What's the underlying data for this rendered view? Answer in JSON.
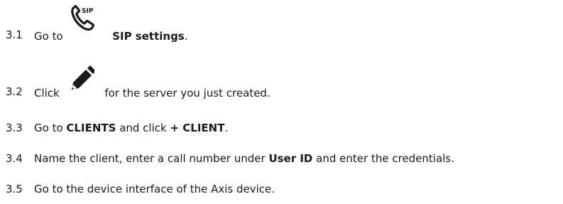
{
  "steps": [
    {
      "number": "3.1",
      "pre": "Go to",
      "icon": "sip-phone-icon",
      "bold": "SIP settings",
      "post": "."
    },
    {
      "number": "3.2",
      "pre": "Click",
      "icon": "pencil-edit-icon",
      "post": "for the server you just created."
    },
    {
      "number": "3.3",
      "pre": "Go to",
      "bold1": "CLIENTS",
      "mid": "and click",
      "bold2": "+ CLIENT",
      "post": "."
    },
    {
      "number": "3.4",
      "pre": "Name the client, enter a call number under",
      "bold": "User ID",
      "post": "and enter the credentials."
    },
    {
      "number": "3.5",
      "text": "Go to the device interface of the Axis device."
    }
  ],
  "icon_labels": {
    "sip": "SIP"
  }
}
